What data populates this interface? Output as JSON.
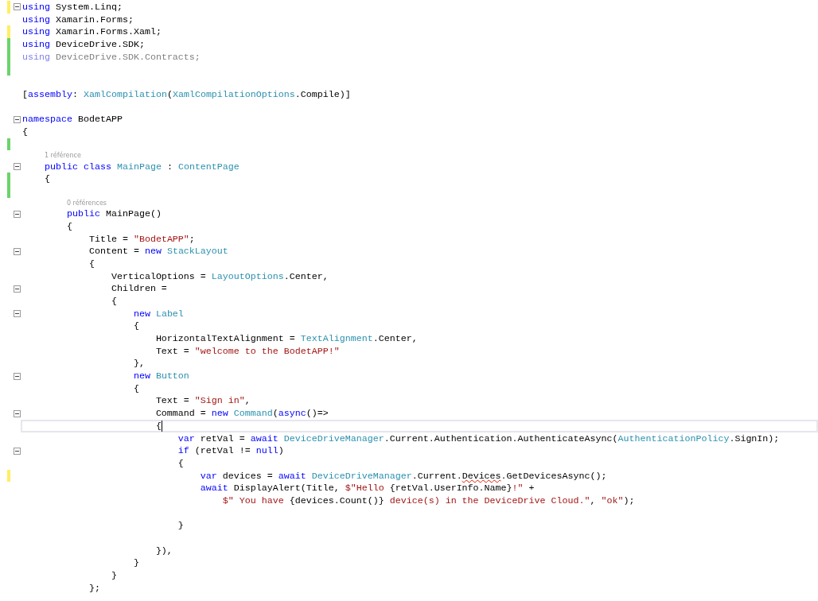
{
  "editor": {
    "lines": [
      {
        "kind": "code",
        "color": "#ffee62",
        "expanded": true,
        "tokens": [
          {
            "t": "using",
            "kind": "kw"
          },
          {
            "t": " System.Linq;",
            "kind": "plain"
          }
        ]
      },
      {
        "kind": "code",
        "tokens": [
          {
            "t": "using",
            "kind": "kw"
          },
          {
            "t": " Xamarin.Forms;",
            "kind": "plain"
          }
        ]
      },
      {
        "kind": "code",
        "color": "#ffee62",
        "tokens": [
          {
            "t": "using",
            "kind": "kw"
          },
          {
            "t": " Xamarin.Forms.Xaml;",
            "kind": "plain"
          }
        ]
      },
      {
        "kind": "code",
        "color": "#6bd36b",
        "tokens": [
          {
            "t": "using",
            "kind": "kw"
          },
          {
            "t": " DeviceDrive.SDK;",
            "kind": "plain"
          }
        ]
      },
      {
        "kind": "code",
        "color": "#6bd36b",
        "tokens": [
          {
            "t": "using",
            "kind": "kw_dim"
          },
          {
            "t": " DeviceDrive.SDK.Contracts;",
            "kind": "dim"
          }
        ]
      },
      {
        "kind": "blank",
        "color": "#6bd36b"
      },
      {
        "kind": "blank"
      },
      {
        "kind": "code",
        "tokens": [
          {
            "t": "[",
            "kind": "plain"
          },
          {
            "t": "assembly",
            "kind": "kw"
          },
          {
            "t": ": ",
            "kind": "plain"
          },
          {
            "t": "XamlCompilation",
            "kind": "type"
          },
          {
            "t": "(",
            "kind": "plain"
          },
          {
            "t": "XamlCompilationOptions",
            "kind": "type"
          },
          {
            "t": ".Compile)]",
            "kind": "plain"
          }
        ]
      },
      {
        "kind": "blank"
      },
      {
        "kind": "code",
        "expanded": true,
        "tokens": [
          {
            "t": "namespace",
            "kind": "kw"
          },
          {
            "t": " BodetAPP",
            "kind": "plain"
          }
        ]
      },
      {
        "kind": "code",
        "tokens": [
          {
            "t": "{",
            "kind": "plain"
          }
        ]
      },
      {
        "kind": "blank",
        "color": "#6bd36b"
      },
      {
        "kind": "codelens",
        "text": "1 référence"
      },
      {
        "kind": "code",
        "expanded": true,
        "tokens": [
          {
            "t": "    public class",
            "kind": "kw"
          },
          {
            "t": " MainPage",
            "kind": "type"
          },
          {
            "t": " : ",
            "kind": "plain"
          },
          {
            "t": "ContentPage",
            "kind": "type"
          }
        ]
      },
      {
        "kind": "code",
        "color": "#6bd36b",
        "tokens": [
          {
            "t": "    {",
            "kind": "plain"
          }
        ]
      },
      {
        "kind": "blank",
        "color": "#6bd36b"
      },
      {
        "kind": "codelens",
        "text": "0 références"
      },
      {
        "kind": "code",
        "expanded": true,
        "tokens": [
          {
            "t": "        public",
            "kind": "kw"
          },
          {
            "t": " MainPage()",
            "kind": "plain"
          }
        ]
      },
      {
        "kind": "code",
        "tokens": [
          {
            "t": "        {",
            "kind": "plain"
          }
        ]
      },
      {
        "kind": "code",
        "tokens": [
          {
            "t": "            Title = ",
            "kind": "plain"
          },
          {
            "t": "\"BodetAPP\"",
            "kind": "str"
          },
          {
            "t": ";",
            "kind": "plain"
          }
        ]
      },
      {
        "kind": "code",
        "expanded": true,
        "tokens": [
          {
            "t": "            Content = ",
            "kind": "plain"
          },
          {
            "t": "new",
            "kind": "kw"
          },
          {
            "t": " StackLayout",
            "kind": "type"
          }
        ]
      },
      {
        "kind": "code",
        "tokens": [
          {
            "t": "            {",
            "kind": "plain"
          }
        ]
      },
      {
        "kind": "code",
        "tokens": [
          {
            "t": "                VerticalOptions = ",
            "kind": "plain"
          },
          {
            "t": "LayoutOptions",
            "kind": "type"
          },
          {
            "t": ".Center,",
            "kind": "plain"
          }
        ]
      },
      {
        "kind": "code",
        "expanded": true,
        "tokens": [
          {
            "t": "                Children =",
            "kind": "plain"
          }
        ]
      },
      {
        "kind": "code",
        "tokens": [
          {
            "t": "                {",
            "kind": "plain"
          }
        ]
      },
      {
        "kind": "code",
        "expanded": true,
        "tokens": [
          {
            "t": "                    new",
            "kind": "kw"
          },
          {
            "t": " Label",
            "kind": "type"
          }
        ]
      },
      {
        "kind": "code",
        "tokens": [
          {
            "t": "                    {",
            "kind": "plain"
          }
        ]
      },
      {
        "kind": "code",
        "tokens": [
          {
            "t": "                        HorizontalTextAlignment = ",
            "kind": "plain"
          },
          {
            "t": "TextAlignment",
            "kind": "type"
          },
          {
            "t": ".Center,",
            "kind": "plain"
          }
        ]
      },
      {
        "kind": "code",
        "tokens": [
          {
            "t": "                        Text = ",
            "kind": "plain"
          },
          {
            "t": "\"welcome to the BodetAPP!\"",
            "kind": "str"
          }
        ]
      },
      {
        "kind": "code",
        "tokens": [
          {
            "t": "                    },",
            "kind": "plain"
          }
        ]
      },
      {
        "kind": "code",
        "expanded": true,
        "tokens": [
          {
            "t": "                    new",
            "kind": "kw"
          },
          {
            "t": " Button",
            "kind": "type"
          }
        ]
      },
      {
        "kind": "code",
        "tokens": [
          {
            "t": "                    {",
            "kind": "plain"
          }
        ]
      },
      {
        "kind": "code",
        "tokens": [
          {
            "t": "                        Text = ",
            "kind": "plain"
          },
          {
            "t": "\"Sign in\"",
            "kind": "str"
          },
          {
            "t": ",",
            "kind": "plain"
          }
        ]
      },
      {
        "kind": "code",
        "expanded": true,
        "tokens": [
          {
            "t": "                        Command = ",
            "kind": "plain"
          },
          {
            "t": "new",
            "kind": "kw"
          },
          {
            "t": " Command",
            "kind": "type"
          },
          {
            "t": "(",
            "kind": "plain"
          },
          {
            "t": "async",
            "kind": "kw"
          },
          {
            "t": "()=>",
            "kind": "plain"
          }
        ]
      },
      {
        "kind": "code",
        "current": true,
        "tokens": [
          {
            "t": "                        {",
            "kind": "plain"
          }
        ]
      },
      {
        "kind": "code",
        "tokens": [
          {
            "t": "                            var",
            "kind": "kw"
          },
          {
            "t": " retVal = ",
            "kind": "plain"
          },
          {
            "t": "await",
            "kind": "kw"
          },
          {
            "t": " DeviceDriveManager",
            "kind": "type"
          },
          {
            "t": ".Current.Authentication.AuthenticateAsync(",
            "kind": "plain"
          },
          {
            "t": "AuthenticationPolicy",
            "kind": "type"
          },
          {
            "t": ".SignIn);",
            "kind": "plain"
          }
        ]
      },
      {
        "kind": "code",
        "expanded": true,
        "tokens": [
          {
            "t": "                            if",
            "kind": "kw"
          },
          {
            "t": " (retVal != ",
            "kind": "plain"
          },
          {
            "t": "null",
            "kind": "kw"
          },
          {
            "t": ")",
            "kind": "plain"
          }
        ]
      },
      {
        "kind": "code",
        "tokens": [
          {
            "t": "                            {",
            "kind": "plain"
          }
        ]
      },
      {
        "kind": "code",
        "color": "#ffee62",
        "tokens": [
          {
            "t": "                                var",
            "kind": "kw"
          },
          {
            "t": " devices = ",
            "kind": "plain"
          },
          {
            "t": "await",
            "kind": "kw"
          },
          {
            "t": " DeviceDriveManager",
            "kind": "type"
          },
          {
            "t": ".Current.",
            "kind": "plain"
          },
          {
            "t": "Devices",
            "kind": "error"
          },
          {
            "t": ".GetDevicesAsync();",
            "kind": "plain"
          }
        ]
      },
      {
        "kind": "code",
        "tokens": [
          {
            "t": "                                await",
            "kind": "kw"
          },
          {
            "t": " DisplayAlert(Title, ",
            "kind": "plain"
          },
          {
            "t": "$\"Hello ",
            "kind": "str"
          },
          {
            "t": "{retVal.UserInfo.Name}",
            "kind": "plain"
          },
          {
            "t": "!\"",
            "kind": "str"
          },
          {
            "t": " +",
            "kind": "plain"
          }
        ]
      },
      {
        "kind": "code",
        "tokens": [
          {
            "t": "                                    $\" You have ",
            "kind": "str"
          },
          {
            "t": "{devices.Count()}",
            "kind": "plain"
          },
          {
            "t": " device(s) in the DeviceDrive Cloud.\"",
            "kind": "str"
          },
          {
            "t": ", ",
            "kind": "plain"
          },
          {
            "t": "\"ok\"",
            "kind": "str"
          },
          {
            "t": ");",
            "kind": "plain"
          }
        ]
      },
      {
        "kind": "blank"
      },
      {
        "kind": "code",
        "tokens": [
          {
            "t": "                            }",
            "kind": "plain"
          }
        ]
      },
      {
        "kind": "blank"
      },
      {
        "kind": "code",
        "tokens": [
          {
            "t": "                        }),",
            "kind": "plain"
          }
        ]
      },
      {
        "kind": "code",
        "tokens": [
          {
            "t": "                    }",
            "kind": "plain"
          }
        ]
      },
      {
        "kind": "code",
        "tokens": [
          {
            "t": "                }",
            "kind": "plain"
          }
        ]
      },
      {
        "kind": "code",
        "tokens": [
          {
            "t": "            };",
            "kind": "plain"
          }
        ]
      }
    ]
  }
}
